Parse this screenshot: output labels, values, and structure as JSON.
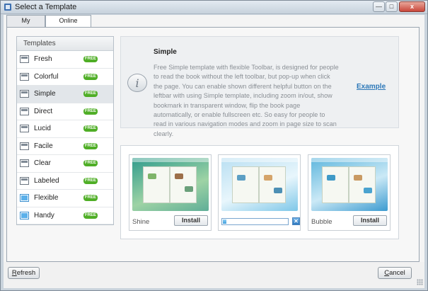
{
  "window": {
    "title": "Select a Template",
    "controls": {
      "minimize": "—",
      "maximize": "□",
      "close": "x"
    }
  },
  "tabs": [
    {
      "label": "My Templates",
      "active": false
    },
    {
      "label": "Online Templates",
      "active": true
    }
  ],
  "templates_panel": {
    "header": "Templates",
    "items": [
      {
        "label": "Fresh",
        "badge": "FREE",
        "selected": false
      },
      {
        "label": "Colorful",
        "badge": "FREE",
        "selected": false
      },
      {
        "label": "Simple",
        "badge": "FREE",
        "selected": true
      },
      {
        "label": "Direct",
        "badge": "FREE",
        "selected": false
      },
      {
        "label": "Lucid",
        "badge": "FREE",
        "selected": false
      },
      {
        "label": "Facile",
        "badge": "FREE",
        "selected": false
      },
      {
        "label": "Clear",
        "badge": "FREE",
        "selected": false
      },
      {
        "label": "Labeled",
        "badge": "FREE",
        "selected": false
      },
      {
        "label": "Flexible",
        "badge": "FREE",
        "selected": false
      },
      {
        "label": "Handy",
        "badge": "FREE",
        "selected": false
      }
    ]
  },
  "description": {
    "title": "Simple",
    "text": "Free Simple template with flexible Toolbar, is designed for people to read the book without the left toolbar, but pop-up when click the page. You can enable shown different helpful button on the leftbar with using Simple template, including zoom in/out, show bookmark in transparent window, flip the book page automatically, or enable fullscreen etc. So easy for people to read in various navigation modes and zoom in page size to scan clearly.",
    "example_link": "Example",
    "info_icon_glyph": "i"
  },
  "preview_cards": [
    {
      "name": "Shine",
      "action": "Install"
    },
    {
      "name": "",
      "download_progress": 0.06
    },
    {
      "name": "Bubble",
      "action": "Install"
    }
  ],
  "footer": {
    "refresh": {
      "underlined": "R",
      "rest": "efresh"
    },
    "cancel": {
      "underlined": "C",
      "rest": "ancel"
    }
  },
  "colors": {
    "free_badge": "#4fae26",
    "link": "#2b77b8",
    "progress": "#3f9edc"
  }
}
